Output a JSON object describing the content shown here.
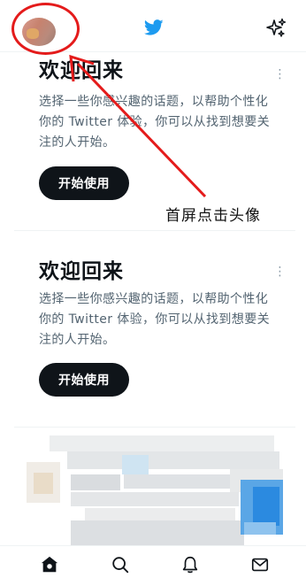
{
  "header": {
    "avatar_icon": "user-avatar",
    "logo_icon": "twitter-bird-icon",
    "logo_color": "#1d9bf0",
    "sparkle_icon": "sparkle-icon"
  },
  "cards": [
    {
      "title": "欢迎回来",
      "description": "选择一些你感兴趣的话题，以帮助个性化你的 Twitter 体验，你可以从找到想要关注的人开始。",
      "button_label": "开始使用",
      "more_icon": "⋮"
    },
    {
      "title": "欢迎回来",
      "description": "选择一些你感兴趣的话题，以帮助个性化你的 Twitter 体验，你可以从找到想要关注的人开始。",
      "button_label": "开始使用",
      "more_icon": "⋮"
    }
  ],
  "annotation": {
    "text": "首屏点击头像",
    "color": "#e41b1b"
  },
  "tabbar": {
    "items": [
      "home-icon",
      "search-icon",
      "notifications-icon",
      "messages-icon"
    ]
  }
}
